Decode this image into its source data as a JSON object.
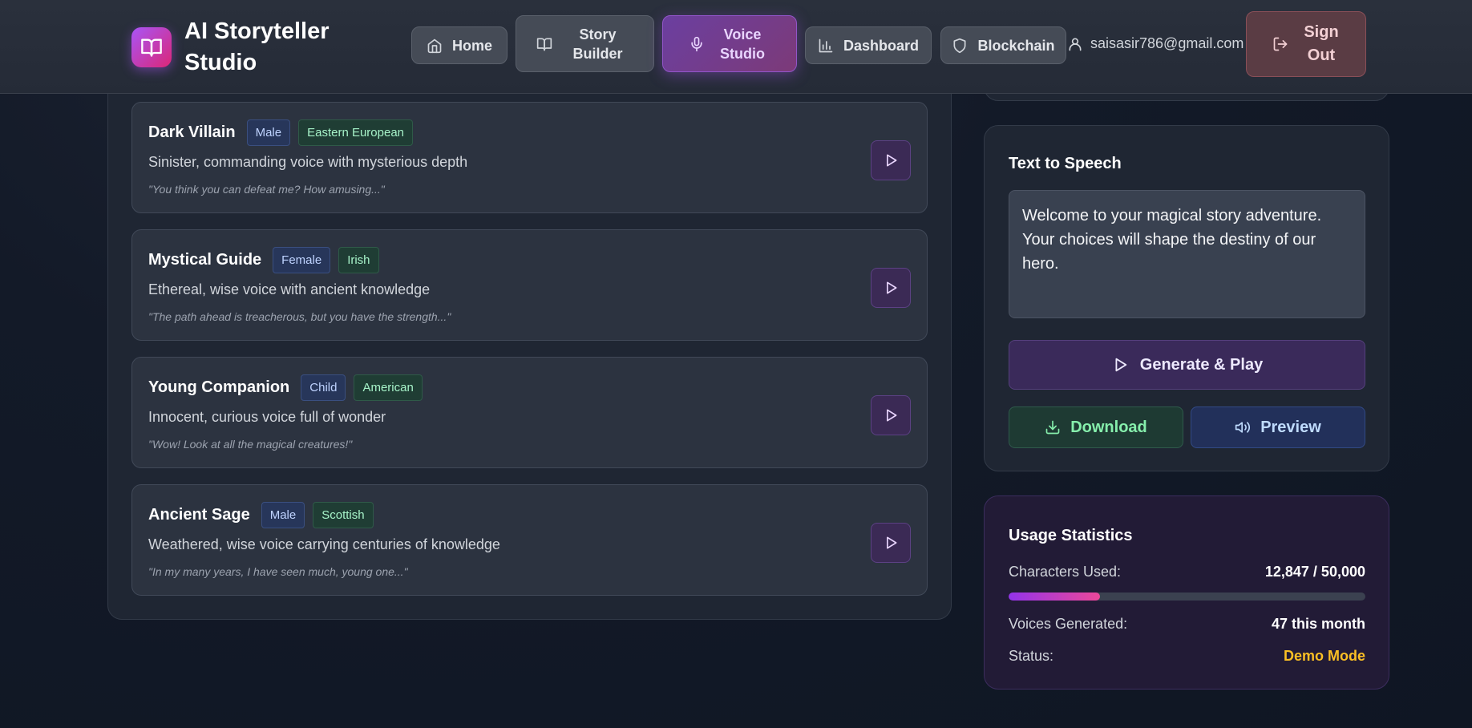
{
  "header": {
    "brand_title": "AI Storyteller Studio",
    "logo_icon": "book-open-icon",
    "nav": {
      "home": "Home",
      "story_builder": "Story Builder",
      "voice_studio": "Voice Studio",
      "dashboard": "Dashboard",
      "blockchain": "Blockchain"
    },
    "active_nav": "voice_studio",
    "user_email": "saisasir786@gmail.com",
    "sign_out": "Sign Out"
  },
  "voices": [
    {
      "name": "Dark Villain",
      "tags": [
        "Male",
        "Eastern European"
      ],
      "description": "Sinister, commanding voice with mysterious depth",
      "sample": "\"You think you can defeat me? How amusing...\""
    },
    {
      "name": "Mystical Guide",
      "tags": [
        "Female",
        "Irish"
      ],
      "description": "Ethereal, wise voice with ancient knowledge",
      "sample": "\"The path ahead is treacherous, but you have the strength...\""
    },
    {
      "name": "Young Companion",
      "tags": [
        "Child",
        "American"
      ],
      "description": "Innocent, curious voice full of wonder",
      "sample": "\"Wow! Look at all the magical creatures!\""
    },
    {
      "name": "Ancient Sage",
      "tags": [
        "Male",
        "Scottish"
      ],
      "description": "Weathered, wise voice carrying centuries of knowledge",
      "sample": "\"In my many years, I have seen much, young one...\""
    }
  ],
  "tts": {
    "title": "Text to Speech",
    "text": "Welcome to your magical story adventure. Your choices will shape the destiny of our hero.",
    "generate_label": "Generate & Play",
    "download_label": "Download",
    "preview_label": "Preview"
  },
  "stats": {
    "title": "Usage Statistics",
    "characters_label": "Characters Used:",
    "characters_value": "12,847 / 50,000",
    "characters_fraction": 0.257,
    "voices_label": "Voices Generated:",
    "voices_value": "47 this month",
    "status_label": "Status:",
    "status_value": "Demo Mode"
  },
  "colors": {
    "accent": "#a855f7",
    "status_demo": "#fbbf24"
  }
}
